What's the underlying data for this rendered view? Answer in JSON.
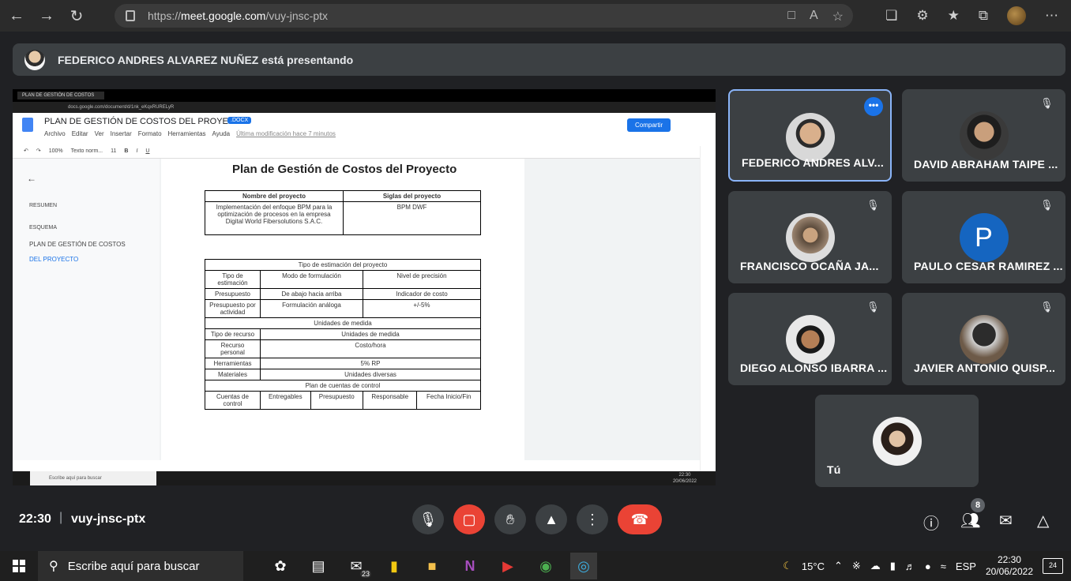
{
  "browser": {
    "url_prefix": "https://",
    "url_host": "meet.google.com",
    "url_path": "/vuy-jnsc-ptx"
  },
  "banner": {
    "presenter_text": "FEDERICO ANDRES ALVAREZ NUÑEZ está presentando"
  },
  "presentation": {
    "tab_title": "PLAN DE GESTIÓN DE COSTOS",
    "address": "docs.google.com/document/d/1nk_eKqxRURELyR",
    "doc_title": "PLAN DE GESTIÓN DE COSTOS DEL PROYECTO",
    "doc_ext": ".DOCX",
    "menu": [
      "Archivo",
      "Editar",
      "Ver",
      "Insertar",
      "Formato",
      "Herramientas",
      "Ayuda"
    ],
    "last_modified": "Última modificación hace 7 minutos",
    "share_label": "Compartir",
    "zoom": "100%",
    "style": "Texto norm...",
    "font_size": "11",
    "outline": {
      "resumen": "RESUMEN",
      "esquema": "ESQUEMA",
      "item1": "PLAN DE GESTIÓN DE COSTOS",
      "item2": "DEL PROYECTO"
    },
    "doc_heading": "Plan de Gestión de Costos del Proyecto",
    "t1": {
      "h1": "Nombre del proyecto",
      "h2": "Siglas del proyecto",
      "c1": "Implementación del enfoque BPM para la optimización de procesos en la empresa Digital World Fibersolutions S.A.C.",
      "c2": "BPM DWF"
    },
    "t2": {
      "title": "Tipo de estimación del proyecto",
      "h1": "Tipo de estimación",
      "h2": "Modo de formulación",
      "h3": "Nivel de precisión",
      "r1a": "Presupuesto",
      "r1b": "De abajo hacia arriba",
      "r1c": "Indicador de costo",
      "r2a": "Presupuesto por actividad",
      "r2b": "Formulación análoga",
      "r2c": "+/-5%",
      "units_title": "Unidades de medida",
      "uh1": "Tipo de recurso",
      "uh2": "Unidades de medida",
      "u1a": "Recurso personal",
      "u1b": "Costo/hora",
      "u2a": "Herramientas",
      "u2b": "5% RP",
      "u3a": "Materiales",
      "u3b": "Unidades diversas",
      "plan_title": "Plan de cuentas de control",
      "ph1": "Cuentas de control",
      "ph2": "Entregables",
      "ph3": "Presupuesto",
      "ph4": "Responsable",
      "ph5": "Fecha Inicio/Fin"
    },
    "taskbar_search": "Escribe aquí para buscar",
    "taskbar_time": "22:30",
    "taskbar_date": "20/06/2022"
  },
  "participants": [
    {
      "name": "FEDERICO ANDRES ALV..."
    },
    {
      "name": "DAVID ABRAHAM TAIPE ..."
    },
    {
      "name": "FRANCISCO OCAÑA JA..."
    },
    {
      "name": "PAULO CESAR RAMIREZ ...",
      "initial": "P"
    },
    {
      "name": "DIEGO ALONSO IBARRA ..."
    },
    {
      "name": "JAVIER ANTONIO QUISP..."
    },
    {
      "name": "Tú"
    }
  ],
  "meeting": {
    "time": "22:30",
    "separator": "|",
    "code": "vuy-jnsc-ptx",
    "people_count": "8"
  },
  "taskbar": {
    "search_placeholder": "Escribe aquí para buscar",
    "mail_badge": "23",
    "temperature": "15°C",
    "language": "ESP",
    "time": "22:30",
    "date": "20/06/2022",
    "notifications": "24"
  },
  "colors": {
    "meet_bg": "#202124",
    "tile_bg": "#3c4043",
    "accent_blue": "#1a73e8",
    "red": "#ea4335"
  }
}
